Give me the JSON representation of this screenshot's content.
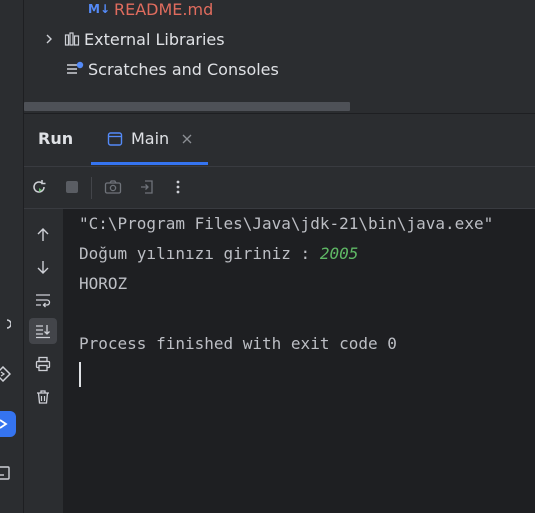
{
  "project_tree": {
    "items": [
      {
        "icon": "markdown-icon",
        "icon_text": "M↓",
        "label": "README.md",
        "color": "#e06c5e"
      },
      {
        "icon": "library-icon",
        "label": "External Libraries",
        "color": "#dfe1e5"
      },
      {
        "icon": "scratches-icon",
        "label": "Scratches and Consoles",
        "color": "#dfe1e5"
      }
    ]
  },
  "run_panel": {
    "title": "Run",
    "tabs": [
      {
        "label": "Main"
      }
    ]
  },
  "console": {
    "lines": [
      {
        "text": "\"C:\\Program Files\\Java\\jdk-21\\bin\\java.exe\""
      },
      {
        "prompt": "Doğum yılınızı giriniz : ",
        "input": "2005"
      },
      {
        "text": "HOROZ"
      },
      {
        "text": ""
      },
      {
        "text": "Process finished with exit code 0"
      }
    ]
  },
  "colors": {
    "accent": "#3574f0",
    "input_green": "#5fb865",
    "readme_red": "#e06c5e"
  }
}
